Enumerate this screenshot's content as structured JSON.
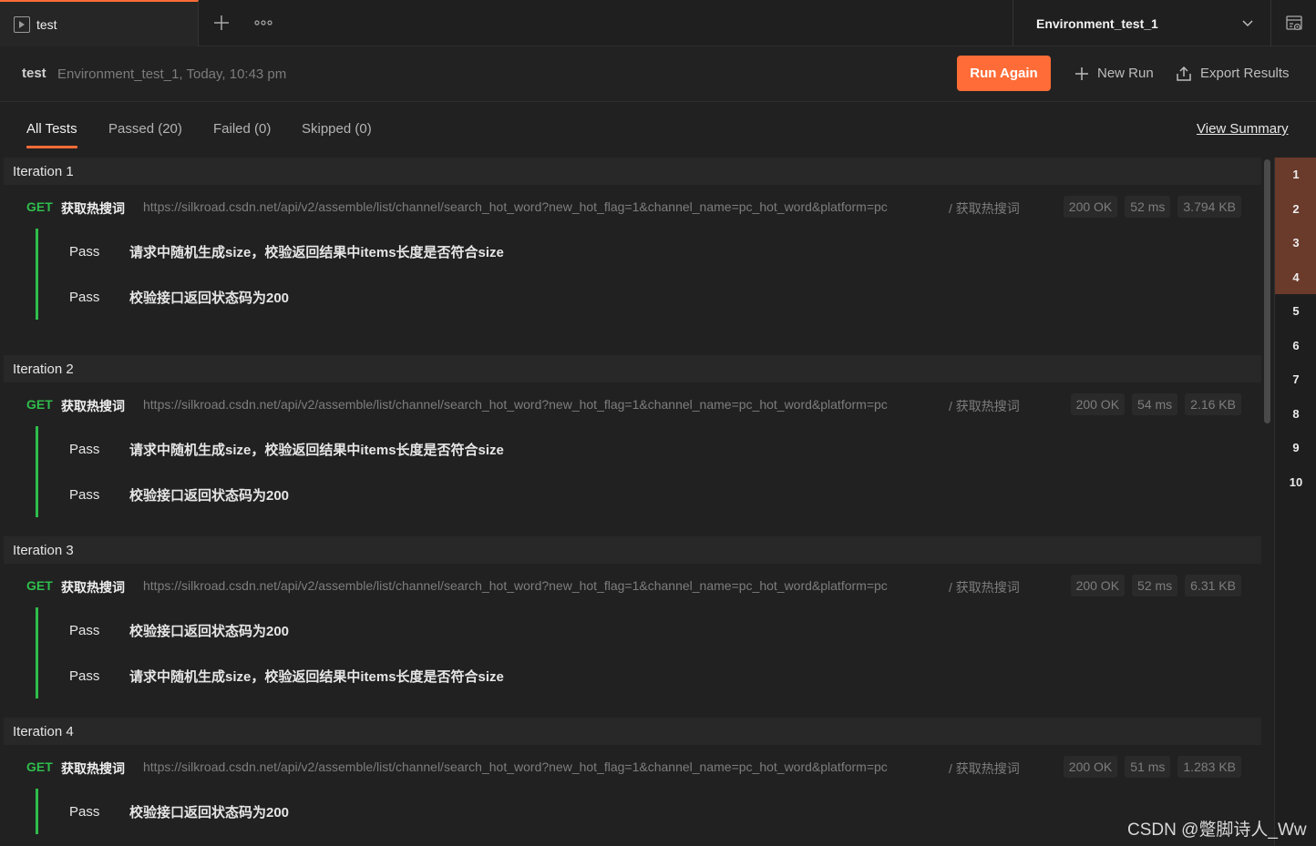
{
  "tab": {
    "label": "test",
    "add_icon": "plus-icon",
    "more_icon": "more-horizontal-icon",
    "tab_icon": "play-square-icon"
  },
  "environment": {
    "name": "Environment_test_1",
    "dropdown_icon": "chevron-down-icon",
    "quicklook_icon": "environment-quick-look-icon"
  },
  "run": {
    "collection": "test",
    "meta": "Environment_test_1, Today, 10:43 pm",
    "run_again": "Run Again",
    "new_run": "New Run",
    "export": "Export Results"
  },
  "filters": {
    "all": "All Tests",
    "passed": "Passed (20)",
    "failed": "Failed (0)",
    "skipped": "Skipped (0)",
    "view_summary": "View Summary"
  },
  "iterations": [
    {
      "title": "Iteration 1",
      "method": "GET",
      "name": "获取热搜词",
      "url": "https://silkroad.csdn.net/api/v2/assemble/list/channel/search_hot_word?new_hot_flag=1&channel_name=pc_hot_word&platform=pc",
      "path": "/ 获取热搜词",
      "status": "200 OK",
      "time": "52 ms",
      "size": "3.794 KB",
      "tests": [
        {
          "result": "Pass",
          "name": "请求中随机生成size，校验返回结果中items长度是否符合size"
        },
        {
          "result": "Pass",
          "name": "校验接口返回状态码为200"
        }
      ]
    },
    {
      "title": "Iteration 2",
      "method": "GET",
      "name": "获取热搜词",
      "url": "https://silkroad.csdn.net/api/v2/assemble/list/channel/search_hot_word?new_hot_flag=1&channel_name=pc_hot_word&platform=pc",
      "path": "/ 获取热搜词",
      "status": "200 OK",
      "time": "54 ms",
      "size": "2.16 KB",
      "tests": [
        {
          "result": "Pass",
          "name": "请求中随机生成size，校验返回结果中items长度是否符合size"
        },
        {
          "result": "Pass",
          "name": "校验接口返回状态码为200"
        }
      ]
    },
    {
      "title": "Iteration 3",
      "method": "GET",
      "name": "获取热搜词",
      "url": "https://silkroad.csdn.net/api/v2/assemble/list/channel/search_hot_word?new_hot_flag=1&channel_name=pc_hot_word&platform=pc",
      "path": "/ 获取热搜词",
      "status": "200 OK",
      "time": "52 ms",
      "size": "6.31 KB",
      "tests": [
        {
          "result": "Pass",
          "name": "校验接口返回状态码为200"
        },
        {
          "result": "Pass",
          "name": "请求中随机生成size，校验返回结果中items长度是否符合size"
        }
      ]
    },
    {
      "title": "Iteration 4",
      "method": "GET",
      "name": "获取热搜词",
      "url": "https://silkroad.csdn.net/api/v2/assemble/list/channel/search_hot_word?new_hot_flag=1&channel_name=pc_hot_word&platform=pc",
      "path": "/ 获取热搜词",
      "status": "200 OK",
      "time": "51 ms",
      "size": "1.283 KB",
      "tests": [
        {
          "result": "Pass",
          "name": "校验接口返回状态码为200"
        }
      ]
    }
  ],
  "iteration_index": [
    {
      "n": "1",
      "state": "failed"
    },
    {
      "n": "2",
      "state": "failed"
    },
    {
      "n": "3",
      "state": "failed"
    },
    {
      "n": "4",
      "state": "failed"
    },
    {
      "n": "5",
      "state": "passed"
    },
    {
      "n": "6",
      "state": "passed"
    },
    {
      "n": "7",
      "state": "passed"
    },
    {
      "n": "8",
      "state": "passed"
    },
    {
      "n": "9",
      "state": "passed"
    },
    {
      "n": "10",
      "state": "passed"
    }
  ],
  "colors": {
    "accent": "#ff6c37",
    "get": "#2fbd4c",
    "pass_bar": "#2fbd4c",
    "index_highlight": "#6a3a2b"
  },
  "watermark": "CSDN @蹩脚诗人_Ww"
}
